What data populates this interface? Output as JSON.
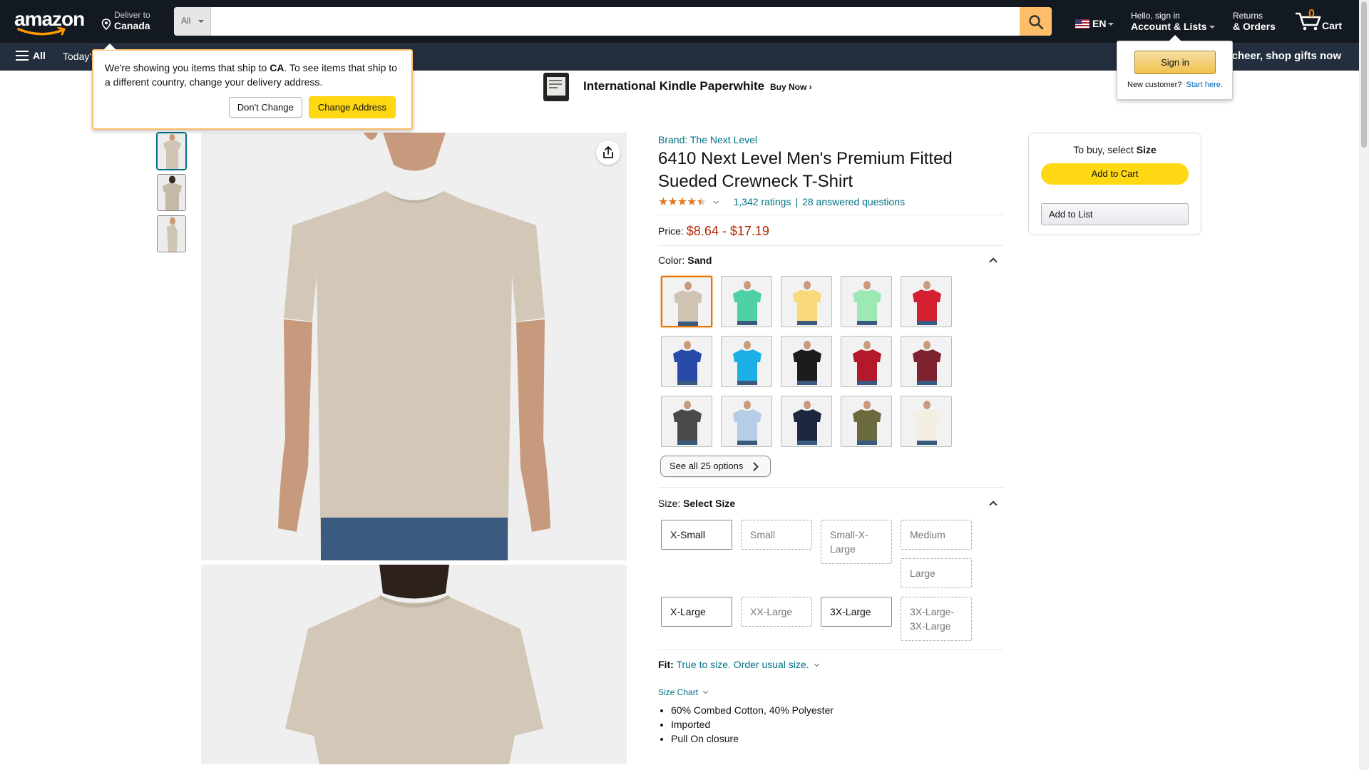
{
  "nav": {
    "logo": "amazon",
    "deliver_to": "Deliver to",
    "deliver_country": "Canada",
    "search_category": "All",
    "search_placeholder": "",
    "language": "EN",
    "account_greeting": "Hello, sign in",
    "account_label": "Account & Lists",
    "returns_l1": "Returns",
    "returns_l2": "& Orders",
    "cart_count": "0",
    "cart_label": "Cart"
  },
  "subnav": {
    "all": "All",
    "today": "Today's",
    "promo": "e cheer, shop gifts now"
  },
  "banner": {
    "title": "International Kindle Paperwhite",
    "cta": "Buy Now ›"
  },
  "ship_popover": {
    "text_pre": "We're showing you items that ship to ",
    "country": "CA",
    "text_post": ". To see items that ship to a different country, change your delivery address.",
    "dont_change": "Don't Change",
    "change_address": "Change Address"
  },
  "sign_popover": {
    "sign_in": "Sign in",
    "new_customer": "New customer?",
    "start_here": "Start here."
  },
  "product": {
    "brand": "Brand: The Next Level",
    "title": "6410 Next Level Men's Premium Fitted Sueded Crewneck T-Shirt",
    "rating_stars": 4.5,
    "ratings": "1,342 ratings",
    "questions": "28 answered questions",
    "price_label": "Price:",
    "price": "$8.64 - $17.19",
    "color_label": "Color:",
    "color_value": "Sand",
    "colors": [
      {
        "name": "Sand",
        "hex": "#cfc4b4",
        "selected": true
      },
      {
        "name": "Teal green",
        "hex": "#4fd1a5",
        "selected": false
      },
      {
        "name": "Banana",
        "hex": "#f8da7c",
        "selected": false
      },
      {
        "name": "Mint",
        "hex": "#9ee8b4",
        "selected": false
      },
      {
        "name": "Red",
        "hex": "#d41f33",
        "selected": false
      },
      {
        "name": "Royal",
        "hex": "#2a4aa8",
        "selected": false
      },
      {
        "name": "Turquoise",
        "hex": "#1ab0e6",
        "selected": false
      },
      {
        "name": "Black",
        "hex": "#1c1c1c",
        "selected": false
      },
      {
        "name": "Cardinal",
        "hex": "#b5182a",
        "selected": false
      },
      {
        "name": "Maroon",
        "hex": "#7e2230",
        "selected": false
      },
      {
        "name": "Heavy Metal",
        "hex": "#4a4a4c",
        "selected": false
      },
      {
        "name": "Light Blue",
        "hex": "#b6cde6",
        "selected": false
      },
      {
        "name": "Midnight Navy",
        "hex": "#1f2740",
        "selected": false
      },
      {
        "name": "Military Green",
        "hex": "#6b6a3e",
        "selected": false
      },
      {
        "name": "Cream",
        "hex": "#f3efe2",
        "selected": false
      }
    ],
    "see_all": "See all 25 options",
    "size_label": "Size:",
    "size_value": "Select Size",
    "sizes": [
      {
        "label": "X-Small",
        "available": true
      },
      {
        "label": "Small",
        "available": false
      },
      {
        "label": "Small-X-Large",
        "available": false
      },
      {
        "label": "Medium",
        "available": false
      },
      {
        "label": "Large",
        "available": false
      },
      {
        "label": "X-Large",
        "available": true
      },
      {
        "label": "XX-Large",
        "available": false
      },
      {
        "label": "3X-Large",
        "available": true
      },
      {
        "label": "3X-Large-3X-Large",
        "available": false
      }
    ],
    "fit_label": "Fit:",
    "fit_value": "True to size. Order usual size.",
    "size_chart": "Size Chart",
    "bullets": [
      "60% Combed Cotton, 40% Polyester",
      "Imported",
      "Pull On closure"
    ]
  },
  "buybox": {
    "to_buy": "To buy, select ",
    "to_buy_bold": "Size",
    "add_to_cart": "Add to Cart",
    "add_to_list": "Add to List"
  },
  "colors": {
    "nav_bg": "#131921",
    "subnav_bg": "#232f3e",
    "link": "#007185",
    "price": "#b12704",
    "accent": "#febd69"
  }
}
